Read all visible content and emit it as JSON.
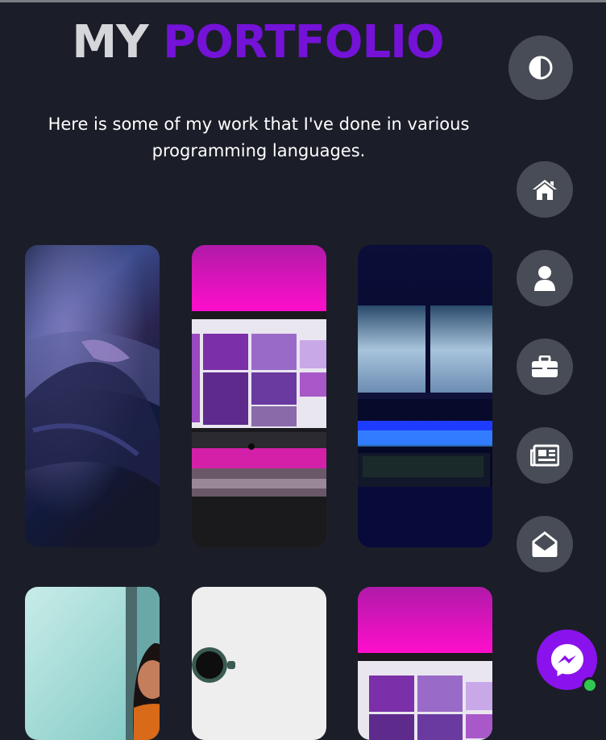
{
  "header": {
    "title_part1": "MY",
    "title_part2": "PORTFOLIO",
    "subtitle": "Here is some of my work that I've done in various programming languages."
  },
  "colors": {
    "background": "#1b1e28",
    "accent": "#7412d8",
    "nav_button": "#474c56",
    "messenger": "#8a12ec",
    "online_status": "#32c850"
  },
  "portfolio": {
    "items": [
      {
        "image": "keyboard-hands-photo"
      },
      {
        "image": "pink-desk-monitor-photo"
      },
      {
        "image": "blue-dual-monitor-setup-photo"
      },
      {
        "image": "smiling-woman-photo"
      },
      {
        "image": "coffee-cup-desk-photo"
      },
      {
        "image": "pink-desk-monitor-photo"
      }
    ]
  },
  "sidebar": {
    "theme_toggle_icon": "contrast-icon",
    "nav": [
      {
        "icon": "home-icon"
      },
      {
        "icon": "user-icon"
      },
      {
        "icon": "briefcase-icon"
      },
      {
        "icon": "newspaper-icon"
      },
      {
        "icon": "envelope-open-icon"
      }
    ]
  },
  "chat": {
    "icon": "messenger-icon",
    "status": "online"
  }
}
